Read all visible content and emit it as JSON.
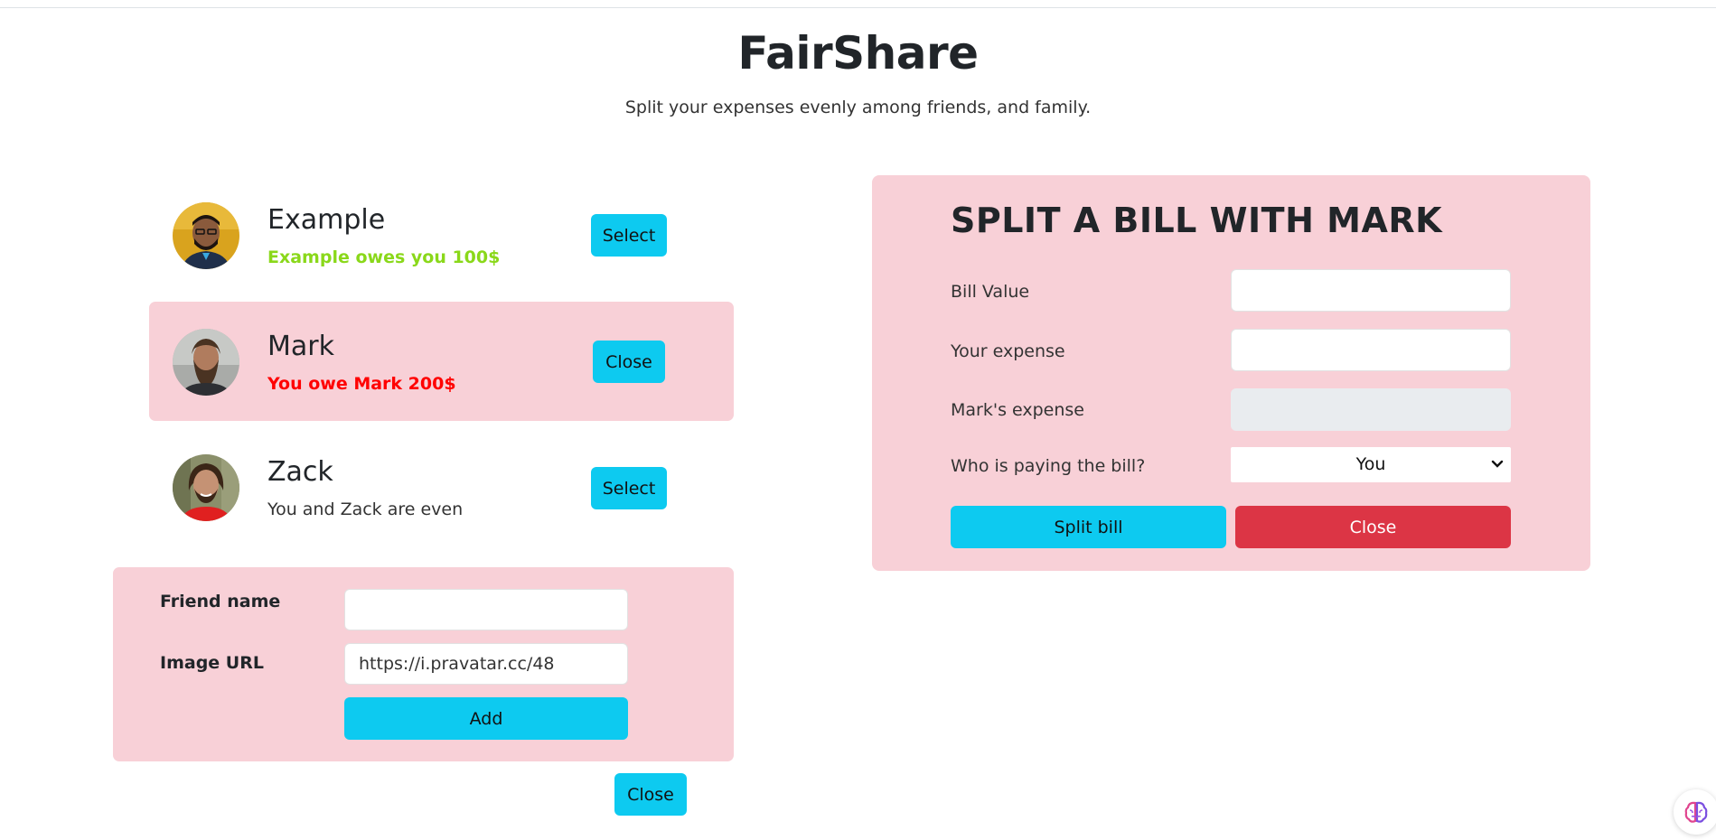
{
  "header": {
    "title": "FairShare",
    "subtitle": "Split your expenses evenly among friends, and family."
  },
  "friends": [
    {
      "name": "Example",
      "status": "Example owes you 100$",
      "button": "Select"
    },
    {
      "name": "Mark",
      "status": "You owe Mark 200$",
      "button": "Close"
    },
    {
      "name": "Zack",
      "status": "You and Zack are even",
      "button": "Select"
    }
  ],
  "add_friend": {
    "name_label": "Friend name",
    "name_value": "",
    "image_label": "Image URL",
    "image_value": "https://i.pravatar.cc/48",
    "add_button": "Add",
    "close_button": "Close"
  },
  "split_bill": {
    "title": "SPLIT A BILL WITH MARK",
    "bill_value_label": "Bill Value",
    "bill_value": "",
    "your_expense_label": "Your expense",
    "your_expense": "",
    "friend_expense_label": "Mark's expense",
    "friend_expense": "",
    "payer_label": "Who is paying the bill?",
    "payer_selected": "You",
    "split_button": "Split bill",
    "close_button": "Close"
  },
  "colors": {
    "accent": "#0dcaf0",
    "panel": "#f8d0d7",
    "danger": "#dc3545",
    "positive": "#8ad81a",
    "negative": "#ff0000"
  },
  "icons": [
    "chevron-down-icon",
    "brain-icon"
  ]
}
